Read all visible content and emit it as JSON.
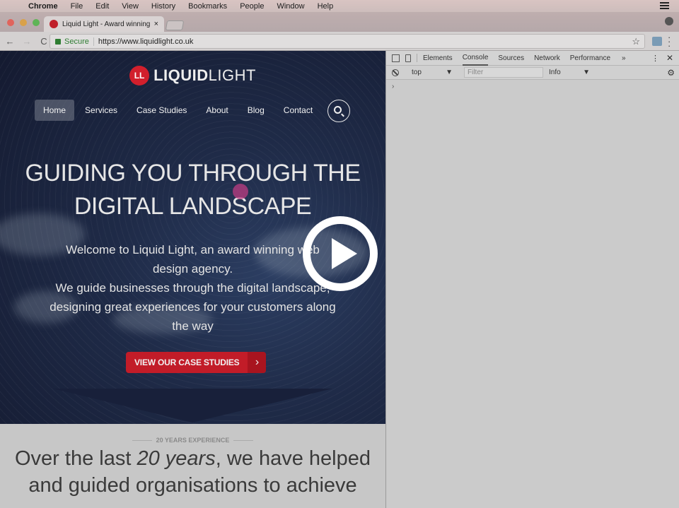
{
  "menubar": {
    "apple": "",
    "items": [
      "Chrome",
      "File",
      "Edit",
      "View",
      "History",
      "Bookmarks",
      "People",
      "Window",
      "Help"
    ]
  },
  "browser": {
    "tab_title": "Liquid Light - Award winning w",
    "tab_close": "×",
    "secure_label": "Secure",
    "url": "https://www.liquidlight.co.uk",
    "back": "←",
    "forward": "→",
    "reload": "C",
    "star": "☆",
    "menu": "⋮"
  },
  "site": {
    "logo_mark": "LL",
    "logo_bold": "LIQUID",
    "logo_light": "LIGHT",
    "nav": [
      "Home",
      "Services",
      "Case Studies",
      "About",
      "Blog",
      "Contact"
    ],
    "active_nav": "Home",
    "headline_line1": "GUIDING YOU THROUGH THE",
    "headline_line2": "DIGITAL LANDSCAPE",
    "intro_line1": "Welcome to Liquid Light, an award winning web",
    "intro_line2": "design agency.",
    "intro_line3": "We guide businesses through the digital landscape,",
    "intro_line4": "designing great experiences for your customers along",
    "intro_line5": "the way",
    "cta_label": "VIEW OUR CASE STUDIES",
    "cta_arrow": "›",
    "eyebrow": "20 YEARS EXPERIENCE",
    "lead_pre": "Over the last ",
    "lead_em": "20 years",
    "lead_post": ", we have helped",
    "lead_line2": "and guided organisations to achieve"
  },
  "devtools": {
    "tabs": [
      "Elements",
      "Console",
      "Sources",
      "Network",
      "Performance"
    ],
    "active_tab": "Console",
    "more": "»",
    "kebab": "⋮",
    "close": "✕",
    "context": "top",
    "context_arrow": "▼",
    "filter_placeholder": "Filter",
    "level": "Info",
    "level_arrow": "▼",
    "gear": "⚙",
    "prompt": "›"
  },
  "colors": {
    "brand_red": "#d21f2c",
    "cta_red": "#c21c28",
    "hero_navy": "#1f2b48"
  }
}
